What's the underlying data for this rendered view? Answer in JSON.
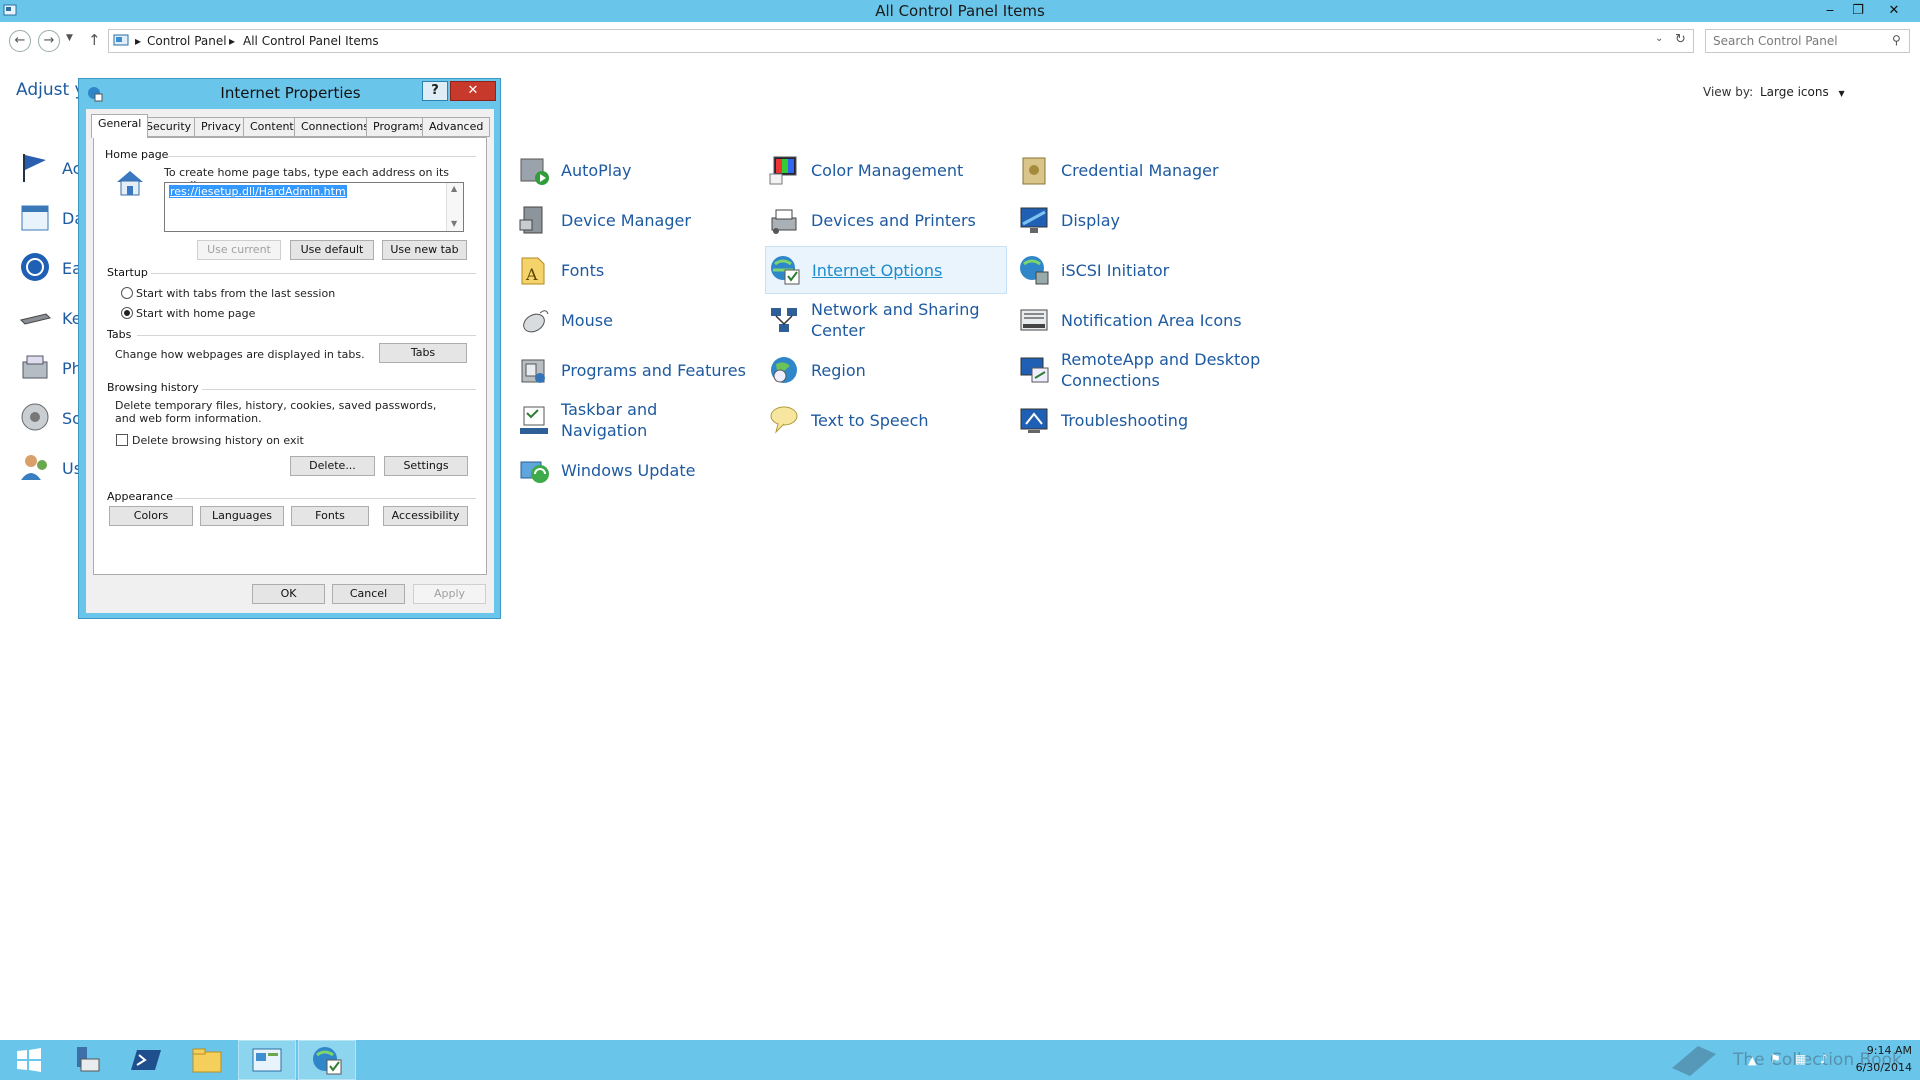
{
  "window": {
    "title": "All Control Panel Items",
    "minimize": "‒",
    "restore": "❐",
    "close": "✕"
  },
  "address": {
    "crumbs": [
      "Control Panel",
      "All Control Panel Items"
    ],
    "search_placeholder": "Search Control Panel"
  },
  "content": {
    "heading_fragment": "Adjust yo",
    "view_by_label": "View by:",
    "view_by_value": "Large icons",
    "left_column_fragments": [
      "Ac",
      "Da",
      "Ea",
      "Ke",
      "Ph",
      "So",
      "Us"
    ],
    "items": [
      {
        "label": "AutoPlay",
        "icon": "autoplay-icon"
      },
      {
        "label": "Color Management",
        "icon": "color-management-icon"
      },
      {
        "label": "Credential Manager",
        "icon": "credential-manager-icon"
      },
      {
        "label": "Device Manager",
        "icon": "device-manager-icon"
      },
      {
        "label": "Devices and Printers",
        "icon": "devices-printers-icon"
      },
      {
        "label": "Display",
        "icon": "display-icon"
      },
      {
        "label": "Fonts",
        "icon": "fonts-icon"
      },
      {
        "label": "Internet Options",
        "icon": "internet-options-icon"
      },
      {
        "label": "iSCSI Initiator",
        "icon": "iscsi-icon"
      },
      {
        "label": "Mouse",
        "icon": "mouse-icon"
      },
      {
        "label": "Network and Sharing Center",
        "icon": "network-icon"
      },
      {
        "label": "Notification Area Icons",
        "icon": "notification-icon"
      },
      {
        "label": "Programs and Features",
        "icon": "programs-icon"
      },
      {
        "label": "Region",
        "icon": "region-icon"
      },
      {
        "label": "RemoteApp and Desktop Connections",
        "icon": "remoteapp-icon"
      },
      {
        "label": "Taskbar and Navigation",
        "icon": "taskbar-icon"
      },
      {
        "label": "Text to Speech",
        "icon": "speech-icon"
      },
      {
        "label": "Troubleshooting",
        "icon": "troubleshooting-icon"
      },
      {
        "label": "Windows Update",
        "icon": "windows-update-icon"
      }
    ],
    "selected_item": "Internet Options"
  },
  "dialog": {
    "title": "Internet Properties",
    "help": "?",
    "close": "✕",
    "tabs": [
      "General",
      "Security",
      "Privacy",
      "Content",
      "Connections",
      "Programs",
      "Advanced"
    ],
    "active_tab": "General",
    "home_page": {
      "heading": "Home page",
      "instructions": "To create home page tabs, type each address on its own line.",
      "value": "res://iesetup.dll/HardAdmin.htm",
      "use_current": "Use current",
      "use_default": "Use default",
      "use_new_tab": "Use new tab"
    },
    "startup": {
      "heading": "Startup",
      "option_last_session": "Start with tabs from the last session",
      "option_home_page": "Start with home page",
      "selected": "Start with home page"
    },
    "tabs_section": {
      "heading": "Tabs",
      "description": "Change how webpages are displayed in tabs.",
      "button": "Tabs"
    },
    "browsing_history": {
      "heading": "Browsing history",
      "description": "Delete temporary files, history, cookies, saved passwords, and web form information.",
      "checkbox_label": "Delete browsing history on exit",
      "checked": false,
      "delete_button": "Delete...",
      "settings_button": "Settings"
    },
    "appearance": {
      "heading": "Appearance",
      "colors": "Colors",
      "languages": "Languages",
      "fonts": "Fonts",
      "accessibility": "Accessibility"
    },
    "footer": {
      "ok": "OK",
      "cancel": "Cancel",
      "apply": "Apply"
    }
  },
  "taskbar": {
    "buttons": [
      "start-icon",
      "server-manager-icon",
      "powershell-icon",
      "file-explorer-icon",
      "control-panel-icon",
      "internet-options-icon"
    ],
    "watermark": "The Collection Book",
    "time": "9:14 AM",
    "date": "6/30/2014"
  },
  "colors": {
    "chrome": "#69c6ea",
    "link": "#1e5aa0",
    "selected_link": "#1d8ccd"
  }
}
